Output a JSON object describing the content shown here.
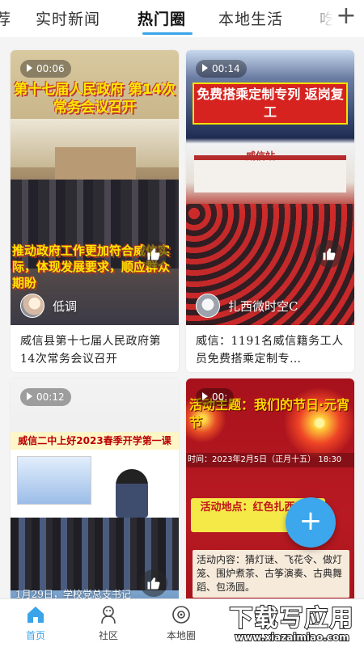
{
  "tabs": [
    {
      "label": "荐",
      "active": false
    },
    {
      "label": "实时新闻",
      "active": false
    },
    {
      "label": "热门圈",
      "active": true
    },
    {
      "label": "本地生活",
      "active": false
    },
    {
      "label": "吃",
      "active": false
    }
  ],
  "tab_add_label": "+",
  "accent_color": "#3aa4ea",
  "cards": [
    {
      "duration": "00:06",
      "overlay_title": "第十七届人民政府 第14次常务会议召开",
      "overlay_text": "推动政府工作更加符合威信实际，体现发展要求，顺应群众期盼",
      "author": "低调",
      "caption": "威信县第十七届人民政府第14次常务会议召开"
    },
    {
      "duration": "00:14",
      "overlay_title": "免费搭乘定制专列 返岗复工",
      "station_sign": "威信站",
      "author": "扎西微时空C",
      "caption": "威信：1191名威信籍务工人员免费搭乘定制专…"
    },
    {
      "duration": "00:12",
      "overlay_title": "威信二中上好2023春季开学第一课",
      "bottom_text": "1月29日，学校党总支书记"
    },
    {
      "duration": "00:",
      "overlay_title": "活动主题：我们的节日·元宵节",
      "date_line": "时间：2023年2月5日（正月十五） 18:30",
      "theme_box": "活动地点：红色扎西广场",
      "content_box": "活动内容：猜灯谜、飞花令、做灯笼、围炉煮茶、古筝演奏、古典舞蹈、包汤圆。"
    }
  ],
  "fab_label": "+",
  "bottom_nav": [
    {
      "label": "首页",
      "icon": "home-icon",
      "active": true
    },
    {
      "label": "社区",
      "icon": "community-icon",
      "active": false
    },
    {
      "label": "本地圈",
      "icon": "local-circle-icon",
      "active": false
    }
  ],
  "watermark": {
    "text": "下载写应用",
    "url": "www.xiazaimiao.com"
  }
}
